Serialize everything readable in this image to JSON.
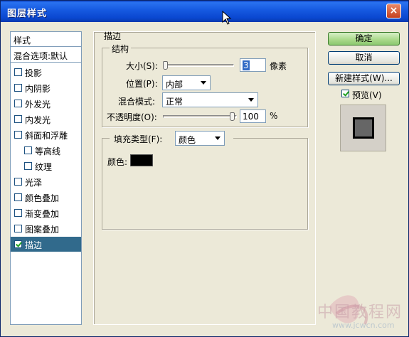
{
  "window": {
    "title": "图层样式",
    "close_label": "×"
  },
  "stylelist": {
    "header": "样式",
    "blend": "混合选项:默认",
    "items": [
      {
        "label": "投影",
        "checked": false,
        "sub": false
      },
      {
        "label": "内阴影",
        "checked": false,
        "sub": false
      },
      {
        "label": "外发光",
        "checked": false,
        "sub": false
      },
      {
        "label": "内发光",
        "checked": false,
        "sub": false
      },
      {
        "label": "斜面和浮雕",
        "checked": false,
        "sub": false
      },
      {
        "label": "等高线",
        "checked": false,
        "sub": true
      },
      {
        "label": "纹理",
        "checked": false,
        "sub": true
      },
      {
        "label": "光泽",
        "checked": false,
        "sub": false
      },
      {
        "label": "颜色叠加",
        "checked": false,
        "sub": false
      },
      {
        "label": "渐变叠加",
        "checked": false,
        "sub": false
      },
      {
        "label": "图案叠加",
        "checked": false,
        "sub": false
      },
      {
        "label": "描边",
        "checked": true,
        "sub": false,
        "selected": true
      }
    ]
  },
  "stroke": {
    "title": "描边",
    "structure": {
      "title": "结构",
      "size_label": "大小(S):",
      "size_value": "3",
      "size_unit": "像素",
      "size_slider_fraction": 0.0,
      "position_label": "位置(P):",
      "position_value": "内部",
      "blend_label": "混合模式:",
      "blend_value": "正常",
      "opacity_label": "不透明度(O):",
      "opacity_value": "100",
      "opacity_unit": "%",
      "opacity_slider_fraction": 1.0
    },
    "fill": {
      "type_label": "填充类型(F):",
      "type_value": "颜色",
      "color_label": "颜色:",
      "color": "#000000"
    }
  },
  "buttons": {
    "ok": "确定",
    "cancel": "取消",
    "new_style": "新建样式(W)...",
    "preview_label": "预览(V)",
    "preview_checked": true
  },
  "watermark": {
    "text": "中国教程网",
    "url": "www.jcwcn.com"
  },
  "colors": {
    "title_bar": "#1559e0",
    "selected_item": "#316a8c",
    "dialog_bg": "#ece9d8"
  }
}
